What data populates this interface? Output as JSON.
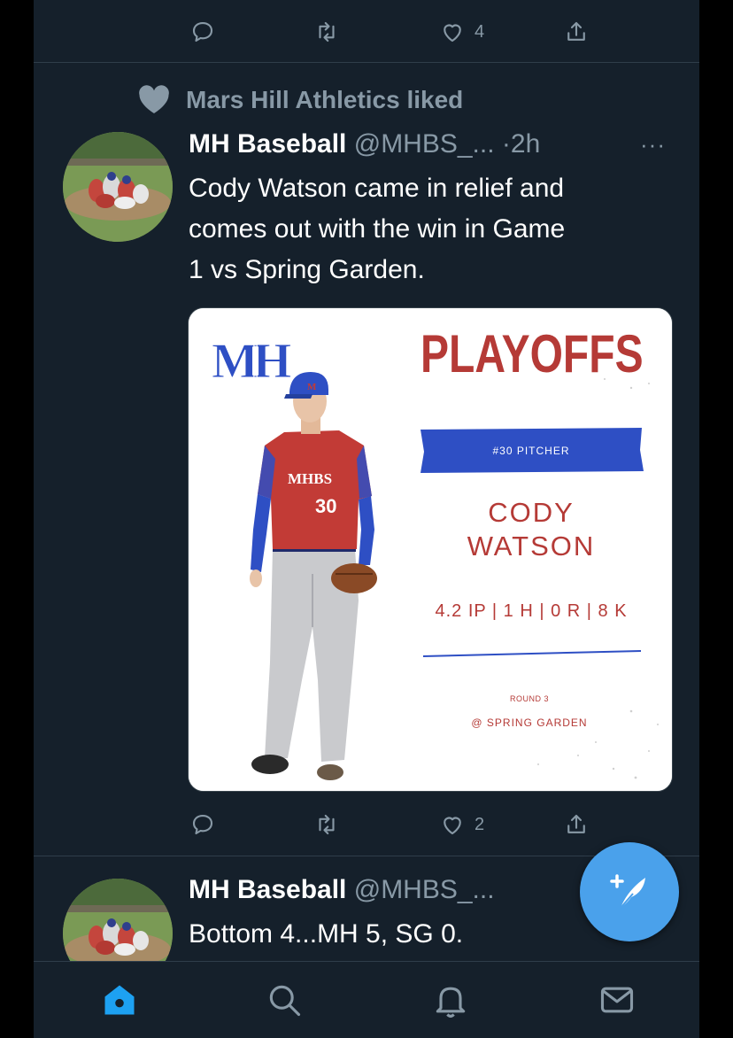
{
  "prev_tweet": {
    "like_count": "4"
  },
  "social_context": {
    "text": "Mars Hill Athletics liked"
  },
  "tweet": {
    "name": "MH Baseball",
    "handle": "@MHBS_...",
    "time": "·2h",
    "more": "···",
    "text": "Cody Watson came in relief and comes out with the win in Game 1 vs Spring Garden.",
    "text_lines": [
      "Cody Watson came in relief and",
      "comes out with the win in Game",
      "1 vs Spring Garden."
    ],
    "reply_count": "",
    "like_count": "2"
  },
  "graphic": {
    "logo": "MH",
    "headline": "PLAYOFFS",
    "banner": "#30 PITCHER",
    "player_first": "CODY",
    "player_last": "WATSON",
    "stats": "4.2 IP | 1 H | 0 R | 8 K",
    "round": "ROUND 3",
    "location": "@ SPRING GARDEN",
    "jersey_text": "MHBS",
    "jersey_number": "30",
    "colors": {
      "red": "#b53a36",
      "blue": "#2e4fc4"
    }
  },
  "next_tweet": {
    "name": "MH Baseball",
    "handle": "@MHBS_...",
    "text": "Bottom 4...MH 5, SG 0."
  },
  "tabs": [
    {
      "icon": "home-icon",
      "active": true
    },
    {
      "icon": "search-icon",
      "active": false
    },
    {
      "icon": "bell-icon",
      "active": false
    },
    {
      "icon": "mail-icon",
      "active": false
    }
  ],
  "colors": {
    "background": "#15202b",
    "accent": "#1da1f2",
    "muted": "#8899a6",
    "fab": "#4aa1eb"
  }
}
